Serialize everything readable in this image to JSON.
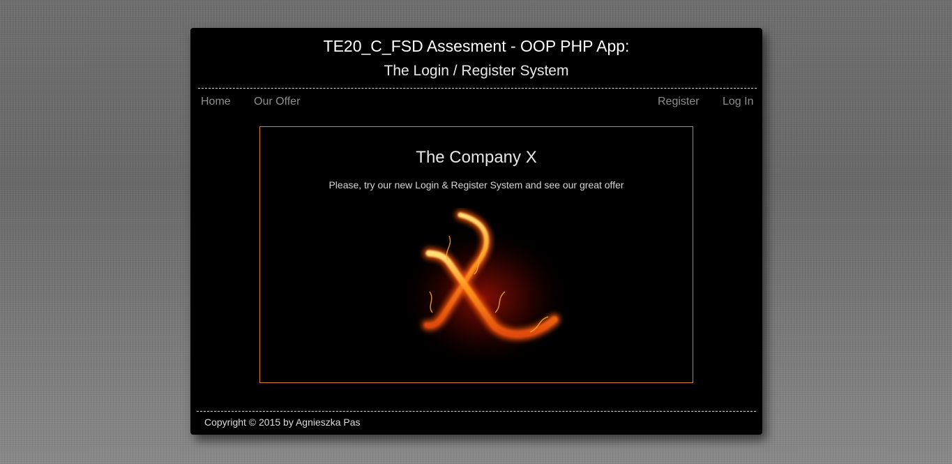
{
  "header": {
    "title": "TE20_C_FSD Assesment - OOP PHP App:",
    "subtitle": "The Login / Register System"
  },
  "nav": {
    "home": "Home",
    "our_offer": "Our Offer",
    "register": "Register",
    "log_in": "Log In"
  },
  "main": {
    "heading": "The Company X",
    "tagline": "Please, try our new Login & Register System and see our great offer",
    "logo_icon": "fire-x-logo-icon"
  },
  "footer": {
    "copyright": "Copyright © 2015 by Agnieszka Pas"
  },
  "colors": {
    "page_background": "#000000",
    "nav_link": "#8d8d8d",
    "box_border": "#e07a35"
  }
}
